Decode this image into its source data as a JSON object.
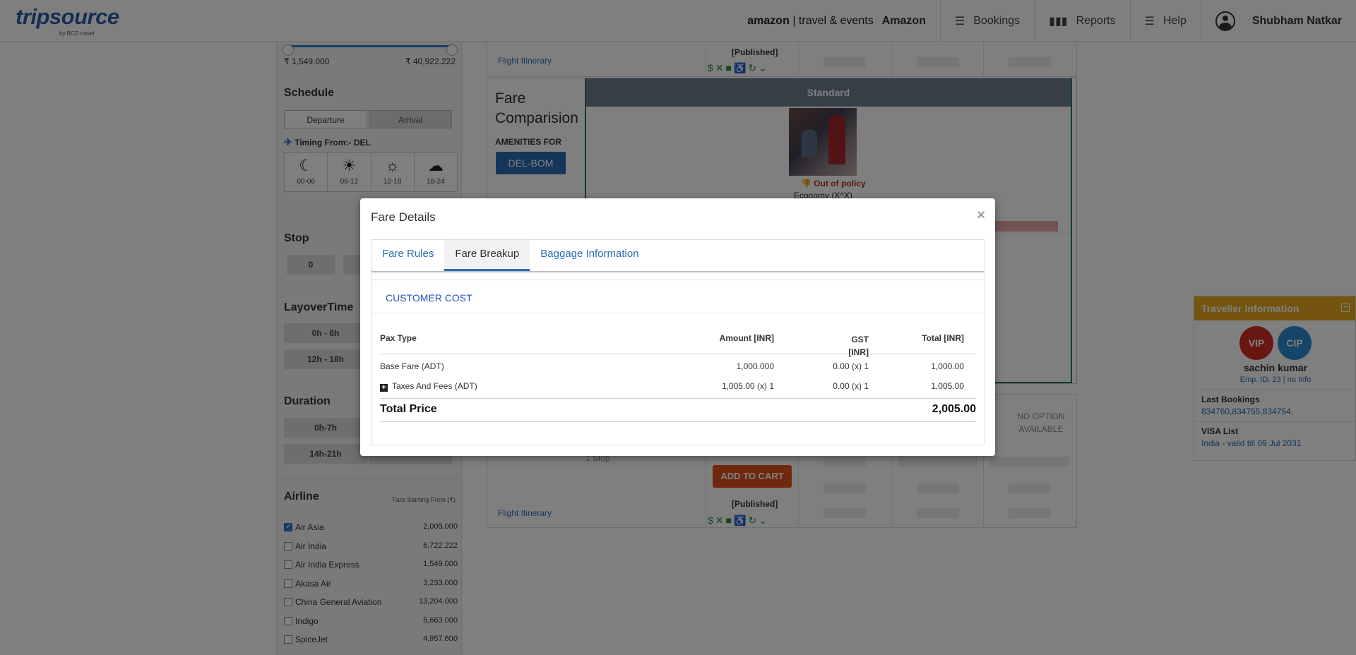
{
  "header": {
    "logo_main": "tripsource",
    "logo_sub": "by BCD travel",
    "partner_logo_brand": "amazon",
    "partner_logo_text": "| travel & events",
    "partner_name": "Amazon",
    "nav": {
      "bookings": "Bookings",
      "reports": "Reports",
      "help": "Help"
    },
    "user_name": "Shubham Natkar"
  },
  "filters": {
    "price_min": "₹ 1,549.000",
    "price_max": "₹ 40,922.222",
    "schedule_title": "Schedule",
    "schedule_tabs": [
      "Departure",
      "Arrival"
    ],
    "timing_label": "Timing From:- DEL",
    "time_slots": [
      {
        "label": "00-06",
        "icon": "moon-icon"
      },
      {
        "label": "06-12",
        "icon": "sunrise-icon"
      },
      {
        "label": "12-18",
        "icon": "sun-icon"
      },
      {
        "label": "18-24",
        "icon": "sunset-icon"
      }
    ],
    "stop_title": "Stop",
    "stop_options": [
      "0"
    ],
    "layover_title": "LayoverTime",
    "layover_options": [
      "0h - 6h",
      "12h - 18h"
    ],
    "duration_title": "Duration",
    "duration_options": [
      "0h-7h",
      "14h-21h"
    ],
    "airline_title": "Airline",
    "fare_starting_label": "Fare Starting From (₹)",
    "airlines": [
      {
        "name": "Air Asia",
        "fare": "2,005.000",
        "checked": true
      },
      {
        "name": "Air India",
        "fare": "6,722.222",
        "checked": false
      },
      {
        "name": "Air India Express",
        "fare": "1,549.000",
        "checked": false
      },
      {
        "name": "Akasa Air",
        "fare": "3,233.000",
        "checked": false
      },
      {
        "name": "China General Aviation",
        "fare": "13,204.000",
        "checked": false
      },
      {
        "name": "Indigo",
        "fare": "5,663.000",
        "checked": false
      },
      {
        "name": "SpiceJet",
        "fare": "4,957.600",
        "checked": false
      }
    ]
  },
  "results": {
    "flight_itinerary": "Flight Itinerary",
    "published": "[Published]",
    "fare_comparision_title": "Fare Comparision",
    "amenities_for": "AMENITIES FOR",
    "route": "DEL-BOM",
    "standard_label": "Standard",
    "out_of_policy": "Out of policy",
    "economy_label": "Economy (X^X)",
    "no_option": "NO OPTION AVAILABLE",
    "stops_text": "1 Stop",
    "add_to_cart": "ADD TO CART"
  },
  "traveller": {
    "title": "Traveller Information",
    "badge_vip": "VIP",
    "badge_cip": "CIP",
    "name": "sachin kumar",
    "emp": "Emp. ID: 23 | no Info",
    "last_bookings_label": "Last Bookings",
    "last_bookings_value": "834760,834755,834754,",
    "visa_label": "VISA List",
    "visa_value": "India - valid till 09 Jul 2031"
  },
  "modal": {
    "title": "Fare Details",
    "close": "×",
    "tabs": [
      "Fare Rules",
      "Fare Breakup",
      "Baggage Information"
    ],
    "active_tab": "Fare Breakup",
    "section_title": "CUSTOMER COST",
    "columns": {
      "pax_type": "Pax Type",
      "amount": "Amount [INR]",
      "gst_line1": "GST",
      "gst_line2": "[INR]",
      "total": "Total [INR]"
    },
    "rows": [
      {
        "pax": "Base Fare (ADT)",
        "amount": "1,000.000",
        "gst": "0.00 (x) 1",
        "total": "1,000.00"
      },
      {
        "pax": "Taxes And Fees (ADT)",
        "amount": "1,005.00 (x) 1",
        "gst": "0.00 (x) 1",
        "total": "1,005.00"
      }
    ],
    "total_label": "Total Price",
    "total_value": "2,005.00"
  },
  "colors": {
    "brand_blue": "#2a5fa8",
    "link_blue": "#2a6db5",
    "traveller_header": "#e9a81f",
    "vip_red": "#d22f27",
    "cip_blue": "#2b8ad0",
    "add_to_cart": "#e0531f"
  }
}
